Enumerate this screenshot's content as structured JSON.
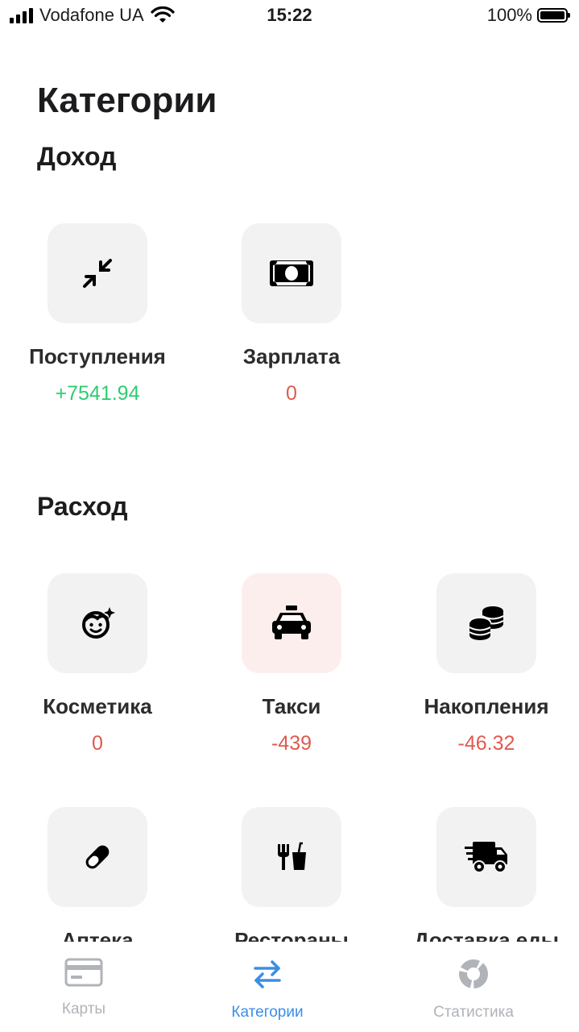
{
  "status_bar": {
    "carrier": "Vodafone UA",
    "time": "15:22",
    "battery": "100%"
  },
  "page": {
    "title": "Категории"
  },
  "income": {
    "title": "Доход",
    "items": [
      {
        "name": "Поступления",
        "amount": "+7541.94",
        "icon": "compress-arrows-icon"
      },
      {
        "name": "Зарплата",
        "amount": "0",
        "icon": "money-bill-icon"
      }
    ]
  },
  "expense": {
    "title": "Расход",
    "items": [
      {
        "name": "Косметика",
        "amount": "0",
        "icon": "face-sparkle-icon"
      },
      {
        "name": "Такси",
        "amount": "-439",
        "icon": "taxi-icon"
      },
      {
        "name": "Накопления",
        "amount": "-46.32",
        "icon": "coins-icon"
      },
      {
        "name": "Аптека",
        "amount": "",
        "icon": "pill-icon"
      },
      {
        "name": "Рестораны",
        "amount": "",
        "icon": "utensils-icon"
      },
      {
        "name": "Доставка еды",
        "amount": "",
        "icon": "delivery-truck-icon"
      }
    ]
  },
  "tabbar": {
    "tabs": [
      {
        "label": "Карты",
        "icon": "card-icon"
      },
      {
        "label": "Категории",
        "icon": "swap-arrows-icon",
        "active": true
      },
      {
        "label": "Статистика",
        "icon": "donut-chart-icon"
      }
    ]
  },
  "colors": {
    "accent": "#3a8ee6",
    "positive": "#2ecc71",
    "negative": "#e05a4f",
    "tile_bg": "#f2f2f3",
    "tile_active_bg": "#fdeeee"
  }
}
